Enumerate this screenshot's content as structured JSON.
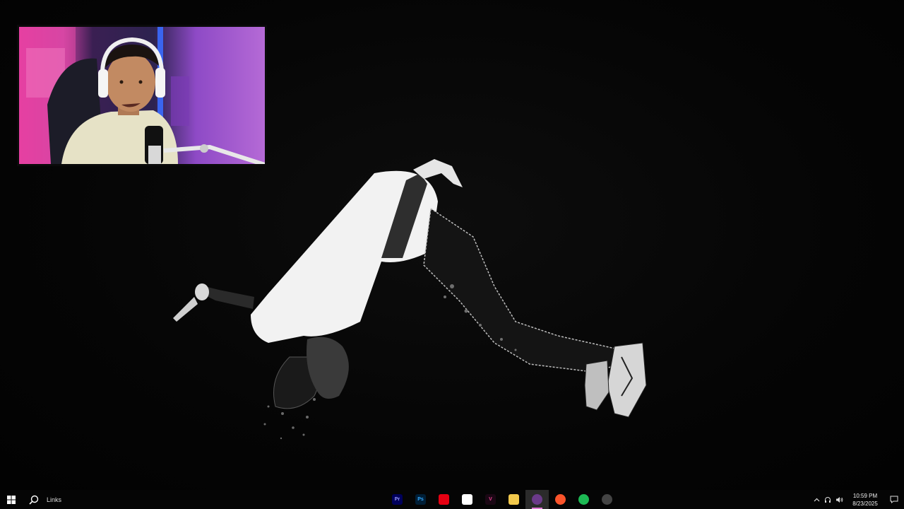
{
  "desktop": {
    "wallpaper_icon": "figure-in-flight",
    "webcam_icon": "streamer-webcam"
  },
  "taskbar": {
    "start_icon": "windows-logo-icon",
    "search_icon": "search-icon",
    "toolbar_label": "Links",
    "apps": [
      {
        "name": "premiere-pro",
        "label": "Pr",
        "bg": "#00005b",
        "fg": "#9999ff",
        "active": false
      },
      {
        "name": "photoshop",
        "label": "Ps",
        "bg": "#001e36",
        "fg": "#31a8ff",
        "active": false
      },
      {
        "name": "nintendo-switch",
        "label": "",
        "bg": "#e60012",
        "fg": "#ffffff",
        "active": false
      },
      {
        "name": "discord",
        "label": "",
        "bg": "#ffffff",
        "fg": "#000000",
        "active": false
      },
      {
        "name": "vegas",
        "label": "V",
        "bg": "#1a0714",
        "fg": "#e73f8e",
        "active": false
      },
      {
        "name": "file-explorer",
        "label": "",
        "bg": "#f2c94c",
        "fg": "#8a6a10",
        "active": false
      },
      {
        "name": "obs-studio",
        "label": "",
        "bg": "#6b3a8a",
        "fg": "#ffffff",
        "active": true
      },
      {
        "name": "brave-browser",
        "label": "",
        "bg": "#fb542b",
        "fg": "#ffffff",
        "active": false
      },
      {
        "name": "spotify",
        "label": "",
        "bg": "#1db954",
        "fg": "#000000",
        "active": false
      },
      {
        "name": "recorder",
        "label": "",
        "bg": "#444444",
        "fg": "#e03b3b",
        "active": false
      }
    ],
    "tray": {
      "chevron_icon": "chevron-up-icon",
      "headset_icon": "headset-icon",
      "volume_icon": "volume-icon",
      "time": "10:59 PM",
      "date": "8/23/2025",
      "notification_icon": "notification-icon"
    }
  }
}
